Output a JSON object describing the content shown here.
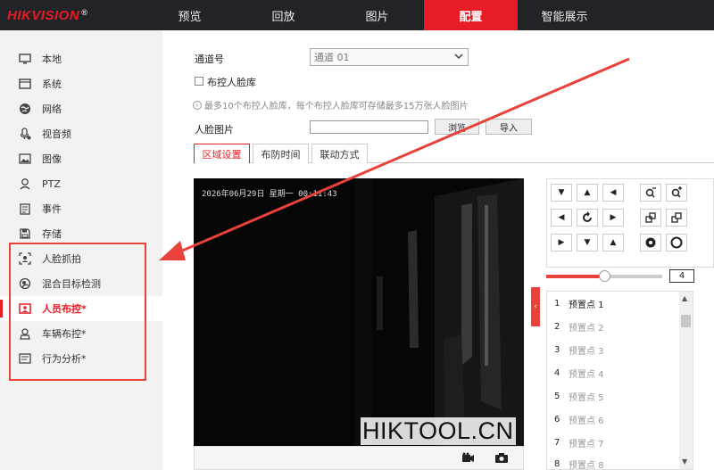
{
  "brand": {
    "logo": "HIKVISION",
    "reg": "®"
  },
  "nav": {
    "tabs": [
      {
        "label": "预览"
      },
      {
        "label": "回放"
      },
      {
        "label": "图片"
      },
      {
        "label": "配置"
      },
      {
        "label": "智能展示"
      }
    ],
    "active": "配置"
  },
  "sidebar": {
    "items": [
      {
        "label": "本地",
        "icon": "monitor-icon"
      },
      {
        "label": "系统",
        "icon": "system-icon"
      },
      {
        "label": "网络",
        "icon": "globe-icon"
      },
      {
        "label": "视音频",
        "icon": "microphone-icon"
      },
      {
        "label": "图像",
        "icon": "image-icon"
      },
      {
        "label": "PTZ",
        "icon": "ptz-icon"
      },
      {
        "label": "事件",
        "icon": "event-icon"
      },
      {
        "label": "存储",
        "icon": "storage-icon"
      },
      {
        "label": "人脸抓拍",
        "icon": "face-capture-icon"
      },
      {
        "label": "混合目标检测",
        "icon": "target-detect-icon"
      },
      {
        "label": "人员布控*",
        "icon": "person-monitor-icon"
      },
      {
        "label": "车辆布控*",
        "icon": "vehicle-monitor-icon"
      },
      {
        "label": "行为分析*",
        "icon": "behavior-icon"
      }
    ],
    "active": "人员布控*"
  },
  "form": {
    "channel_label": "通道号",
    "channel_value": "通道 01",
    "facelib_label": "布控人脸库",
    "hint": "最多10个布控人脸库，每个布控人脸库可存储最多15万张人脸图片",
    "face_image_label": "人脸图片",
    "browse": "浏览",
    "import": "导入"
  },
  "tabs": [
    {
      "label": "区域设置"
    },
    {
      "label": "布防时间"
    },
    {
      "label": "联动方式"
    }
  ],
  "video": {
    "osd": "2026年06月29日 星期一 00:11:43"
  },
  "ptz": {
    "speed": "4",
    "speed_fraction": 0.5
  },
  "presets": [
    {
      "num": "1",
      "name": "预置点 1"
    },
    {
      "num": "2",
      "name": "预置点 2"
    },
    {
      "num": "3",
      "name": "预置点 3"
    },
    {
      "num": "4",
      "name": "预置点 4"
    },
    {
      "num": "5",
      "name": "预置点 5"
    },
    {
      "num": "6",
      "name": "预置点 6"
    },
    {
      "num": "7",
      "name": "预置点 7"
    },
    {
      "num": "8",
      "name": "预置点 8"
    }
  ],
  "watermark": "HIKTOOL.CN",
  "colors": {
    "accent": "#e81c24",
    "annotation": "#e8423b",
    "topbar": "#222326"
  }
}
